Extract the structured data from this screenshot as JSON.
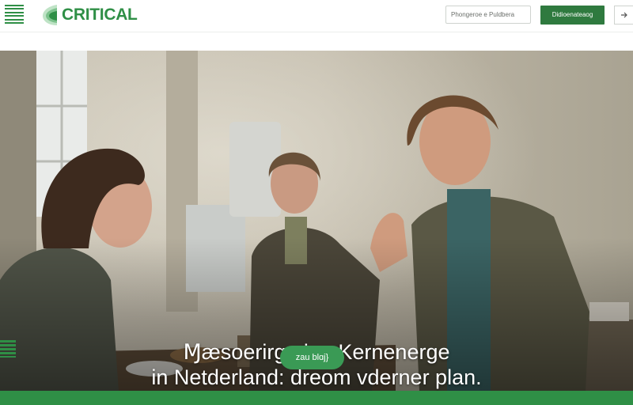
{
  "header": {
    "logo_text": "CRITICAL",
    "search_placeholder": "Phongeroe e Puldbera",
    "cta_label": "Didioenateaog",
    "menu_icon": "hamburger-icon",
    "arrow_icon": "arrow-right-icon"
  },
  "hero": {
    "headline_line1": "Ɱæsoerirge iŋe Kernenerge",
    "headline_line2": "in Netderland: dreom vderner plan.",
    "button_label": "zau blɑj}"
  },
  "colors": {
    "brand": "#2f8f46",
    "button_dark": "#2f7a3f",
    "pill": "#3a9a55"
  }
}
